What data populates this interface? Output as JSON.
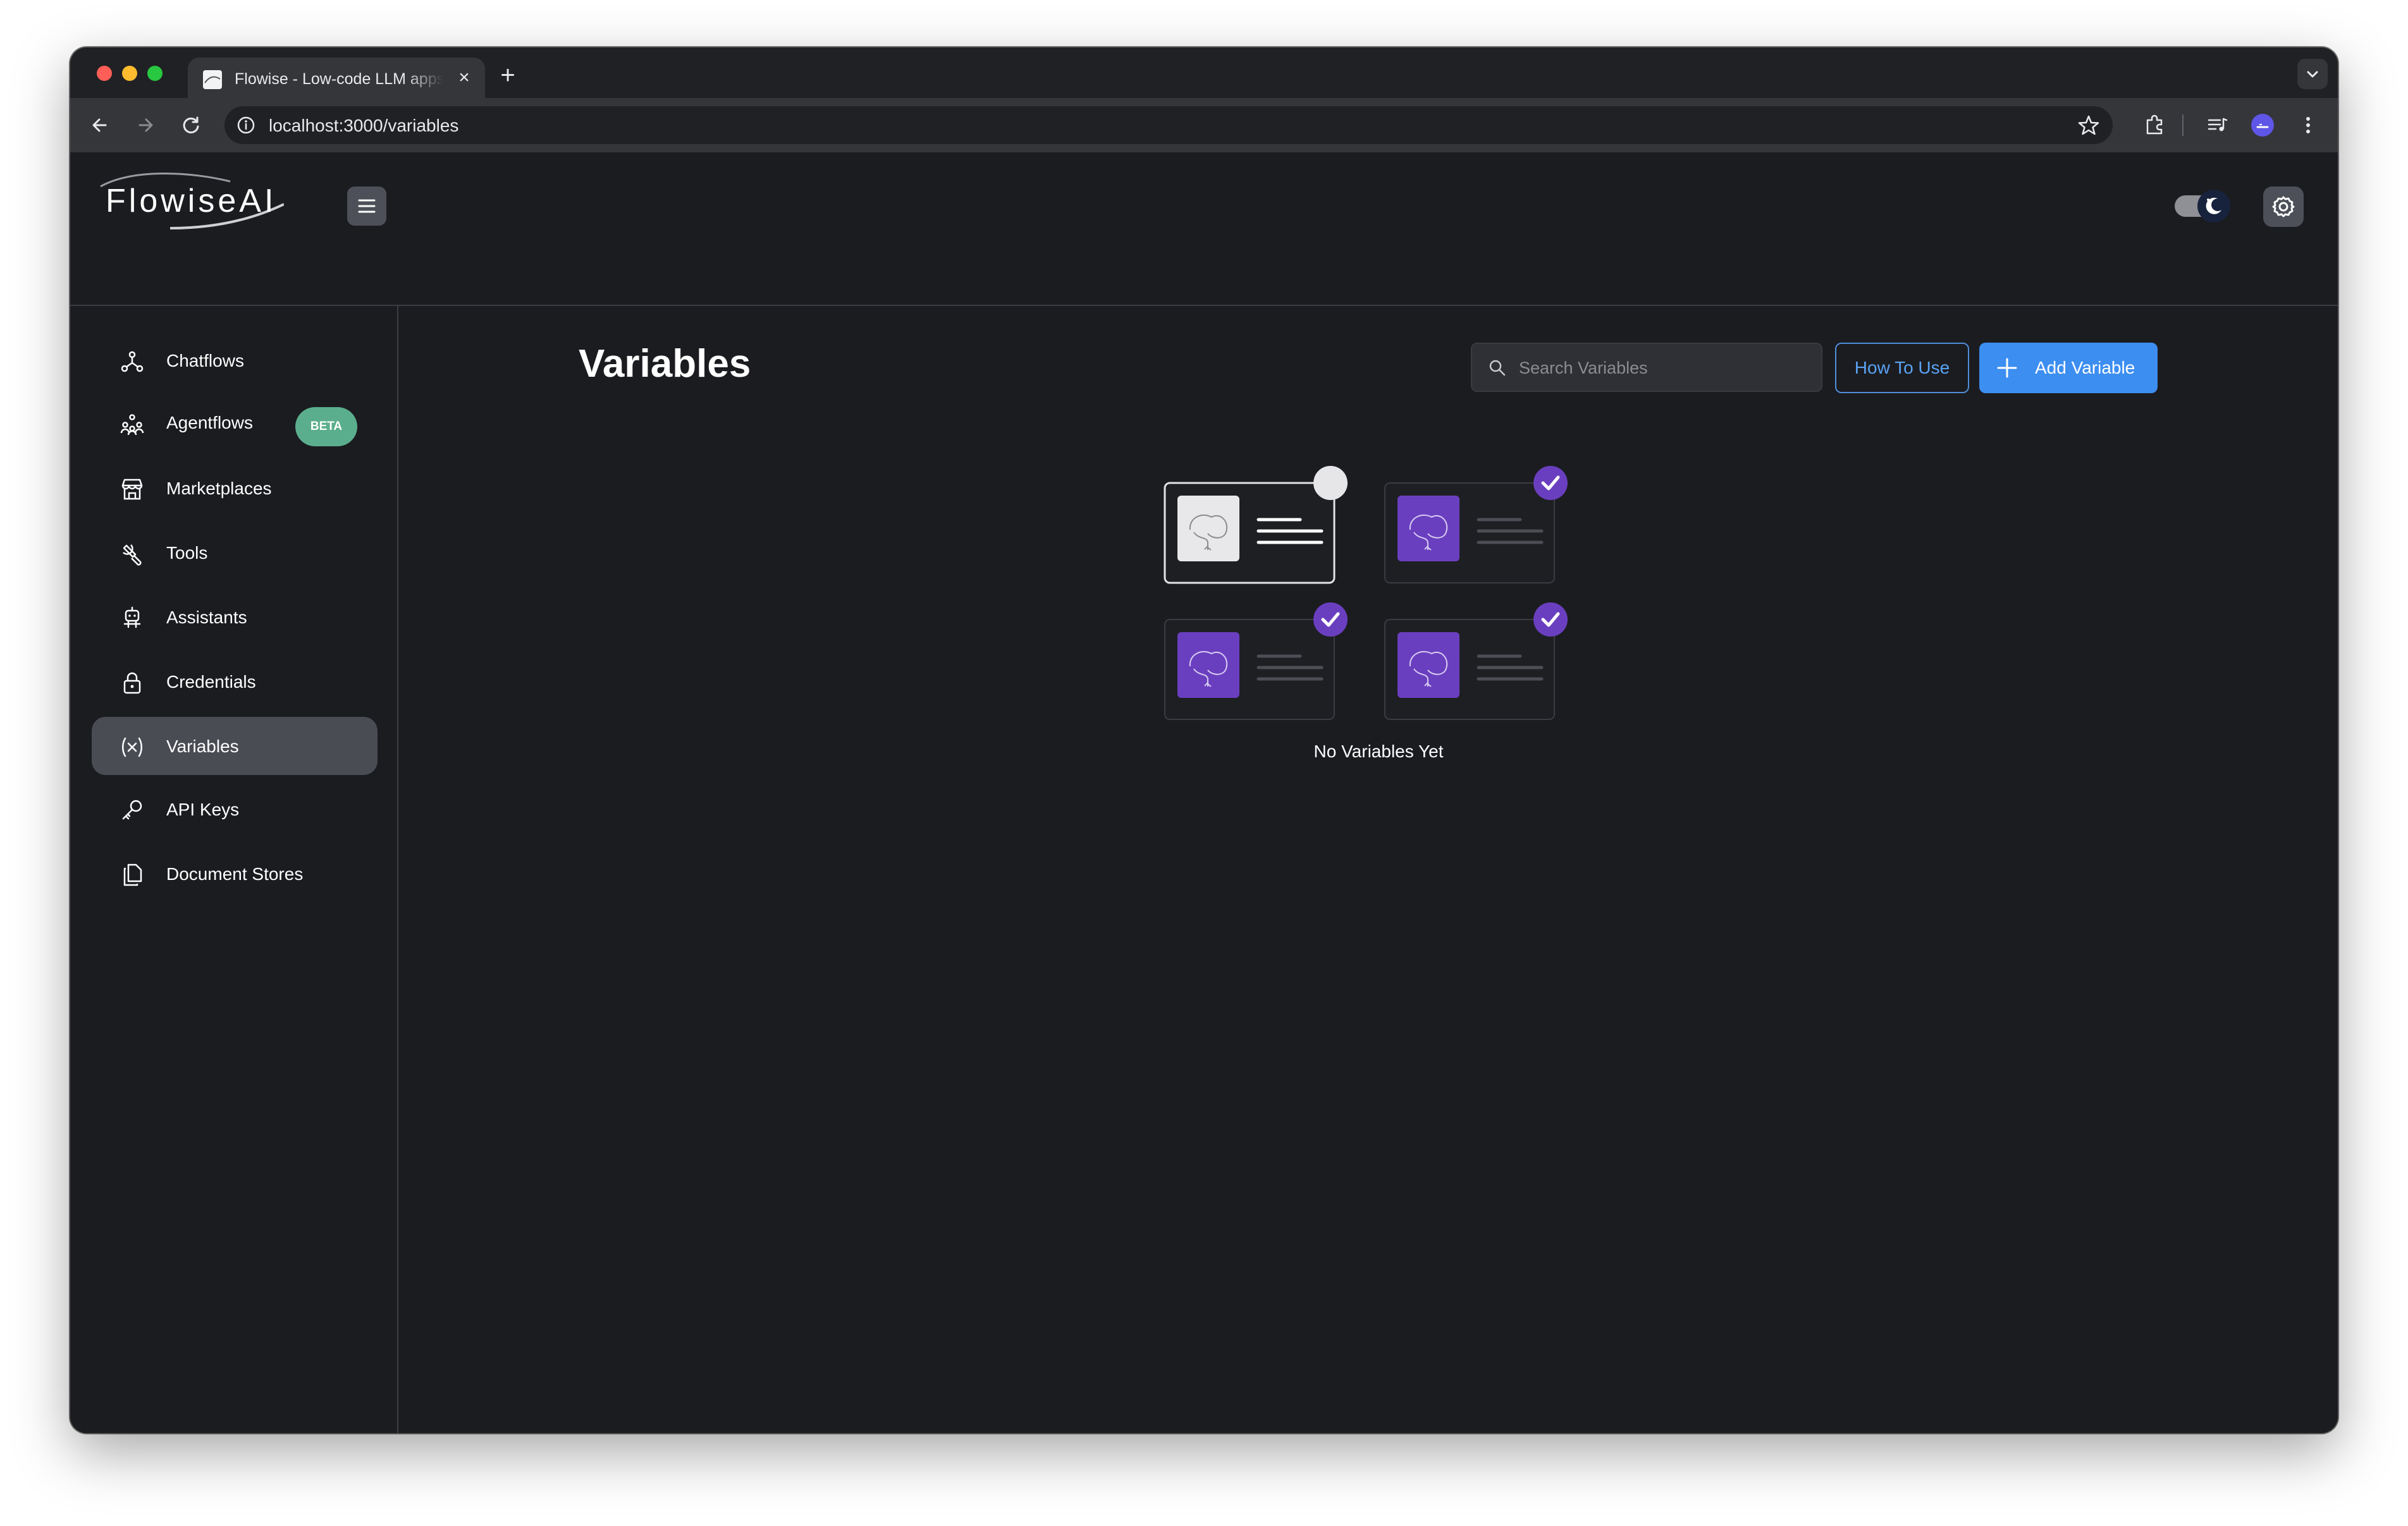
{
  "browser": {
    "tab_title": "Flowise - Low-code LLM apps",
    "url": "localhost:3000/variables"
  },
  "app": {
    "brand": "FlowiseAI",
    "sidebar": {
      "items": [
        {
          "label": "Chatflows",
          "icon": "chatflows-icon"
        },
        {
          "label": "Agentflows",
          "icon": "agentflows-icon",
          "badge": "BETA"
        },
        {
          "label": "Marketplaces",
          "icon": "marketplace-icon"
        },
        {
          "label": "Tools",
          "icon": "tools-icon"
        },
        {
          "label": "Assistants",
          "icon": "assistants-icon"
        },
        {
          "label": "Credentials",
          "icon": "lock-icon"
        },
        {
          "label": "Variables",
          "icon": "variables-icon",
          "active": true
        },
        {
          "label": "API Keys",
          "icon": "key-icon"
        },
        {
          "label": "Document Stores",
          "icon": "document-stores-icon"
        }
      ]
    },
    "main": {
      "title": "Variables",
      "search_placeholder": "Search Variables",
      "how_to_label": "How To Use",
      "add_label": "Add Variable",
      "empty_message": "No Variables Yet"
    }
  },
  "colors": {
    "background": "#1b1c20",
    "accent": "#3c8ef0",
    "purple": "#6a3fbf",
    "beta_badge": "#5bae8d"
  }
}
